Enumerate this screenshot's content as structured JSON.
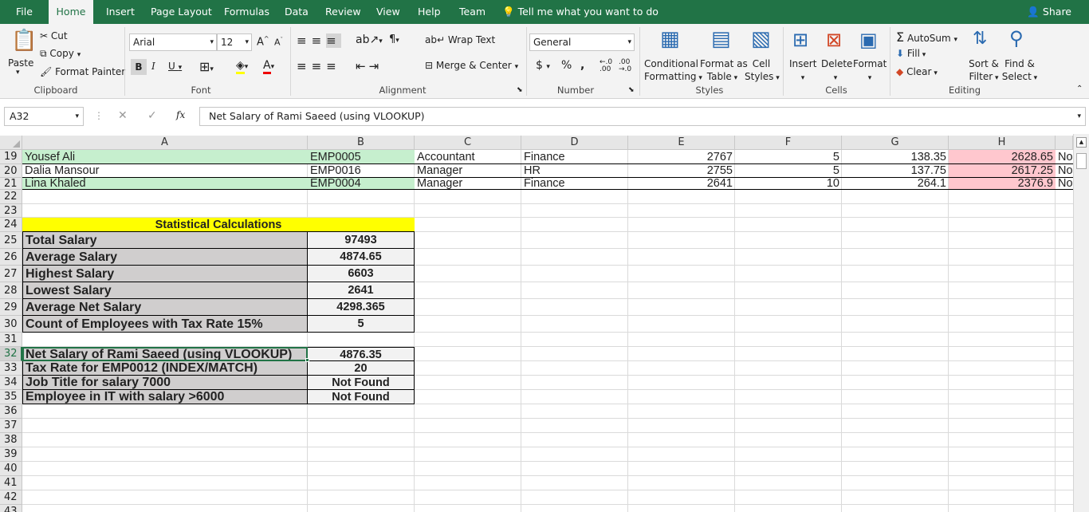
{
  "menu": {
    "tabs": [
      "File",
      "Home",
      "Insert",
      "Page Layout",
      "Formulas",
      "Data",
      "Review",
      "View",
      "Help",
      "Team"
    ],
    "tell": "Tell me what you want to do",
    "share": "Share"
  },
  "ribbon": {
    "clipboard": {
      "paste": "Paste",
      "cut": "Cut",
      "copy": "Copy",
      "painter": "Format Painter",
      "label": "Clipboard"
    },
    "font": {
      "name": "Arial",
      "size": "12",
      "label": "Font"
    },
    "alignment": {
      "wrap": "Wrap Text",
      "merge": "Merge & Center",
      "label": "Alignment"
    },
    "number": {
      "format": "General",
      "label": "Number"
    },
    "styles": {
      "cond1": "Conditional",
      "cond2": "Formatting",
      "fmt1": "Format as",
      "fmt2": "Table",
      "cell1": "Cell",
      "cell2": "Styles",
      "label": "Styles"
    },
    "cells": {
      "insert": "Insert",
      "delete": "Delete",
      "format": "Format",
      "label": "Cells"
    },
    "editing": {
      "autosum": "AutoSum",
      "fill": "Fill",
      "clear": "Clear",
      "sort1": "Sort &",
      "sort2": "Filter",
      "find1": "Find &",
      "find2": "Select",
      "label": "Editing"
    }
  },
  "formula_bar": {
    "name_box": "A32",
    "content": "Net Salary of Rami Saeed (using VLOOKUP)"
  },
  "columns": [
    "A",
    "B",
    "C",
    "D",
    "E",
    "F",
    "G",
    "H"
  ],
  "rows": [
    "19",
    "20",
    "21",
    "22",
    "23",
    "24",
    "25",
    "26",
    "27",
    "28",
    "29",
    "30",
    "31",
    "32",
    "33",
    "34",
    "35",
    "36",
    "37",
    "38",
    "39",
    "40",
    "41",
    "42",
    "43"
  ],
  "data_rows": [
    {
      "name": "Yousef Ali",
      "id": "EMP0005",
      "title": "Accountant",
      "dept": "Finance",
      "salary": "2767",
      "tax": "5",
      "taxamt": "138.35",
      "net": "2628.65",
      "flag": "No"
    },
    {
      "name": "Dalia Mansour",
      "id": "EMP0016",
      "title": "Manager",
      "dept": "HR",
      "salary": "2755",
      "tax": "5",
      "taxamt": "137.75",
      "net": "2617.25",
      "flag": "No"
    },
    {
      "name": "Lina Khaled",
      "id": "EMP0004",
      "title": "Manager",
      "dept": "Finance",
      "salary": "2641",
      "tax": "10",
      "taxamt": "264.1",
      "net": "2376.9",
      "flag": "No"
    }
  ],
  "stats": {
    "title": "Statistical Calculations",
    "items": [
      {
        "label": "Total Salary",
        "value": "97493"
      },
      {
        "label": "Average Salary",
        "value": "4874.65"
      },
      {
        "label": "Highest Salary",
        "value": "6603"
      },
      {
        "label": "Lowest Salary",
        "value": "2641"
      },
      {
        "label": "Average Net Salary",
        "value": "4298.365"
      },
      {
        "label": "Count of Employees with Tax Rate 15%",
        "value": "5"
      }
    ]
  },
  "lookups": [
    {
      "label": "Net Salary of Rami Saeed (using VLOOKUP)",
      "value": "4876.35"
    },
    {
      "label": "Tax Rate for EMP0012 (INDEX/MATCH)",
      "value": "20"
    },
    {
      "label": "Job Title for salary 7000",
      "value": "Not Found"
    },
    {
      "label": "Employee in IT with salary >6000",
      "value": "Not Found"
    }
  ],
  "colors": {
    "brand": "#217346",
    "green_fill": "#c6efce",
    "red_fill": "#ffc7ce",
    "yellow_fill": "#ffff00",
    "gray_fill": "#d0cece"
  }
}
